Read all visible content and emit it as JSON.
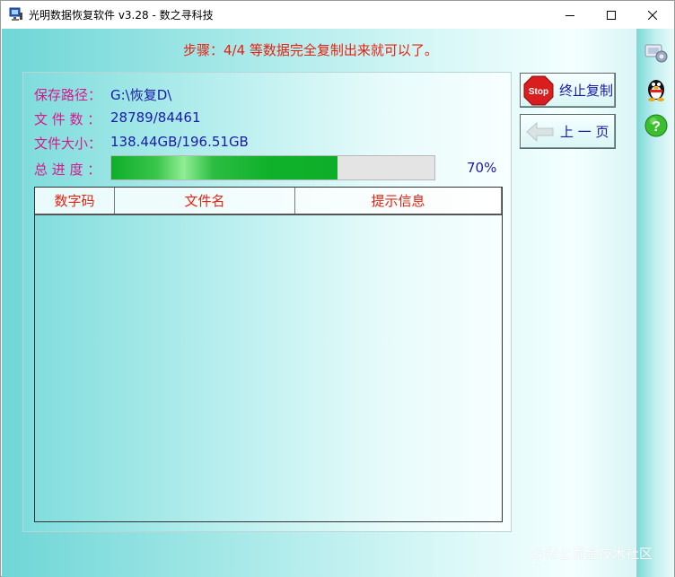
{
  "window": {
    "title": "光明数据恢复软件 v3.28 - 数之寻科技"
  },
  "step_text": "步骤：4/4 等数据完全复制出来就可以了。",
  "info": {
    "save_path_label": "保存路径：",
    "save_path_value": "G:\\恢复D\\",
    "file_count_label": "文 件 数 ：",
    "file_count_value": "28789/84461",
    "file_size_label": "文件大小：",
    "file_size_value": "138.44GB/196.51GB",
    "progress_label": "总 进 度 ：",
    "progress_percent_text": "70%",
    "progress_fraction": 0.7
  },
  "table": {
    "columns": [
      "数字码",
      "文件名",
      "提示信息"
    ],
    "rows": []
  },
  "buttons": {
    "stop_label": "终止复制",
    "stop_icon_text": "Stop",
    "back_label": "上 一 页"
  },
  "sidebar": {
    "icons": [
      "settings-icon",
      "qq-penguin-icon",
      "help-icon"
    ],
    "help_glyph": "?"
  },
  "watermark": "@稀土掘金技术社区",
  "colors": {
    "step_red": "#e8200f",
    "label_magenta": "#d8188c",
    "value_blue": "#1a1aa8",
    "progress_green": "#0fae2a",
    "teal_bg": "#6fd6d6"
  }
}
